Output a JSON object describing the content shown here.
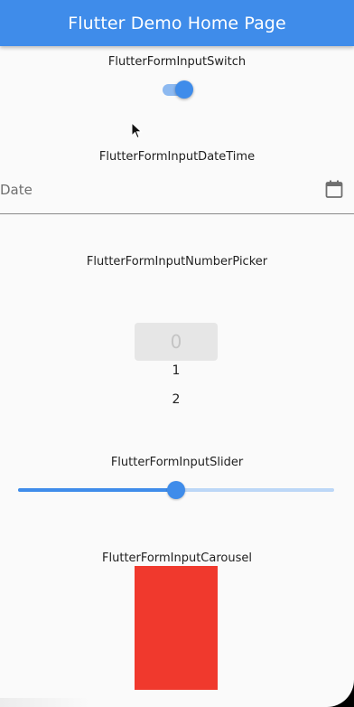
{
  "appbar": {
    "title": "Flutter Demo Home Page",
    "color": "#3f8cea"
  },
  "switch_section": {
    "label": "FlutterFormInputSwitch",
    "value": true
  },
  "datetime_section": {
    "label": "FlutterFormInputDateTime",
    "placeholder": "Date",
    "icon": "calendar-icon"
  },
  "number_picker_section": {
    "label": "FlutterFormInputNumberPicker",
    "selected": "0",
    "options": [
      "1",
      "2"
    ]
  },
  "slider_section": {
    "label": "FlutterFormInputSlider",
    "value_fraction": 0.5
  },
  "carousel_section": {
    "label": "FlutterFormInputCarousel",
    "item_color": "#f0392d"
  }
}
